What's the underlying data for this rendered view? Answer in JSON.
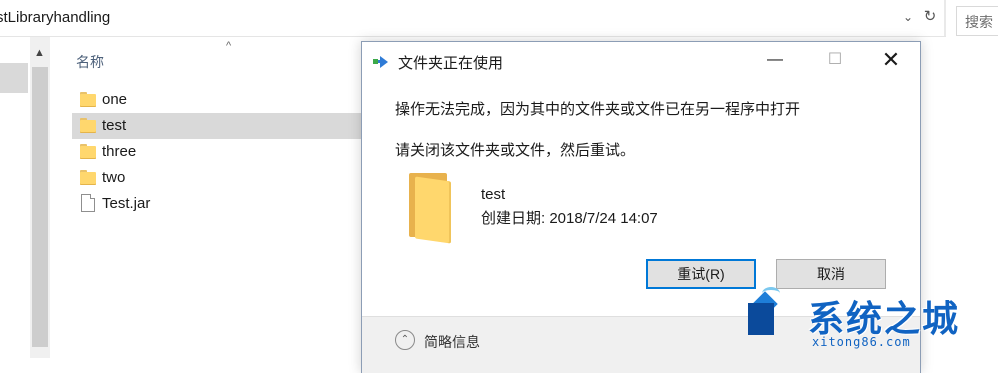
{
  "explorer": {
    "address_path": "stLibraryhandling",
    "search_placeholder": "搜索",
    "column_header": "名称",
    "files": [
      {
        "name": "one",
        "type": "folder"
      },
      {
        "name": "test",
        "type": "folder",
        "selected": true
      },
      {
        "name": "three",
        "type": "folder"
      },
      {
        "name": "two",
        "type": "folder"
      },
      {
        "name": "Test.jar",
        "type": "file"
      }
    ]
  },
  "dialog": {
    "title": "文件夹正在使用",
    "message": "操作无法完成，因为其中的文件夹或文件已在另一程序中打开",
    "instruction": "请关闭该文件夹或文件，然后重试。",
    "item_name": "test",
    "item_date": "创建日期: 2018/7/24 14:07",
    "retry_label": "重试(R)",
    "cancel_label": "取消",
    "details_label": "简略信息",
    "minimize_glyph": "—",
    "maximize_glyph": "☐",
    "close_glyph": "✕"
  },
  "watermark": {
    "title": "系统之城",
    "subtitle": "xitong86.com"
  },
  "colors": {
    "accent": "#0078d7",
    "folder": "#ffd76d",
    "watermark": "#1063c2"
  }
}
